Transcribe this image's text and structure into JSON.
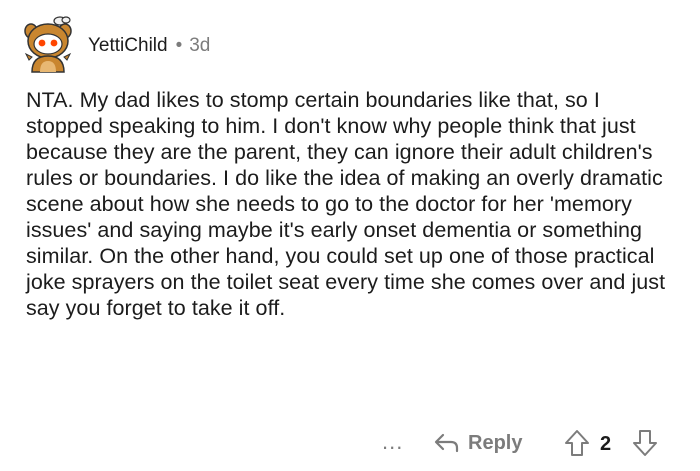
{
  "comment": {
    "author": "YettiChild",
    "separator": "•",
    "age": "3d",
    "body": "NTA. My dad likes to stomp certain boundaries like that, so I stopped speaking to him. I don't know why people think that just because they are the parent, they can ignore their adult children's rules or boundaries. I do like the idea of making an overly dramatic scene about how she needs to go to the doctor for her 'memory issues' and saying maybe it's early onset dementia or something similar. On the other hand, you could set up one of those practical joke sprayers on the toilet seat every time she comes over and just say you forget to take it off."
  },
  "actions": {
    "more_label": "...",
    "reply_label": "Reply",
    "vote_count": "2"
  },
  "icons": {
    "avatar": "snoo-avatar-icon",
    "reply": "reply-arrow-icon",
    "upvote": "upvote-arrow-icon",
    "downvote": "downvote-arrow-icon"
  },
  "colors": {
    "text": "#1c1c1c",
    "meta": "#7c7c7c",
    "background": "#ffffff"
  }
}
